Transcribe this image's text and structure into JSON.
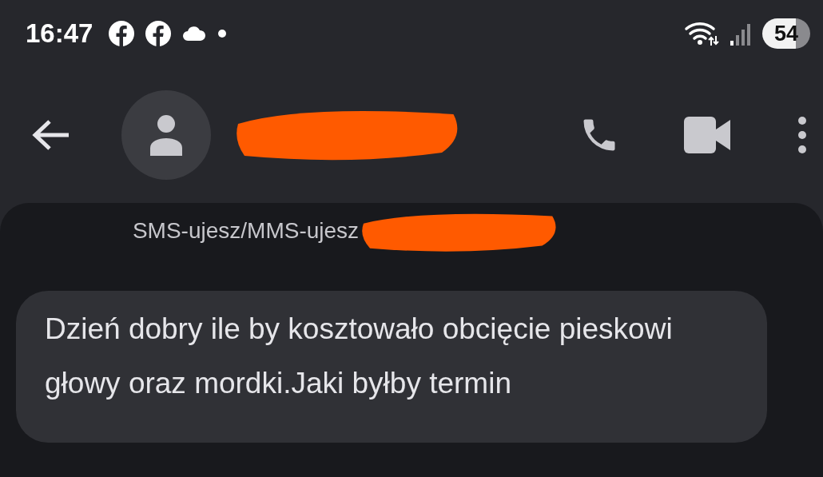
{
  "status_bar": {
    "time": "16:47",
    "battery": "54"
  },
  "conversation": {
    "mode_label": "SMS-ujesz/MMS-ujesz"
  },
  "messages": [
    {
      "text": "Dzień dobry ile by kosztowało obcięcie pieskowi głowy oraz mordki.Jaki byłby termin"
    }
  ]
}
